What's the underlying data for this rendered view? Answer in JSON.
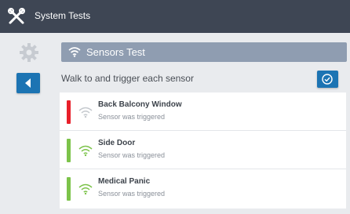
{
  "topbar": {
    "title": "System Tests",
    "icon": "tools-icon"
  },
  "sidebar": {
    "gear_icon": "gear-icon",
    "back_icon": "arrow-left-icon"
  },
  "header": {
    "icon": "wifi-icon",
    "title": "Sensors Test"
  },
  "instruction": "Walk to and trigger each sensor",
  "check_icon": "check-circle-icon",
  "colors": {
    "topbar": "#3e4654",
    "accent": "#1c74b3",
    "header_bar": "#8f9db1",
    "triggered_red": "#e8202a",
    "ok_green": "#7cc34a"
  },
  "sensors": [
    {
      "name": "Back Balcony Window",
      "status": "Sensor was triggered",
      "indicator": "red"
    },
    {
      "name": "Side Door",
      "status": "Sensor was triggered",
      "indicator": "green"
    },
    {
      "name": "Medical Panic",
      "status": "Sensor was triggered",
      "indicator": "green"
    }
  ]
}
